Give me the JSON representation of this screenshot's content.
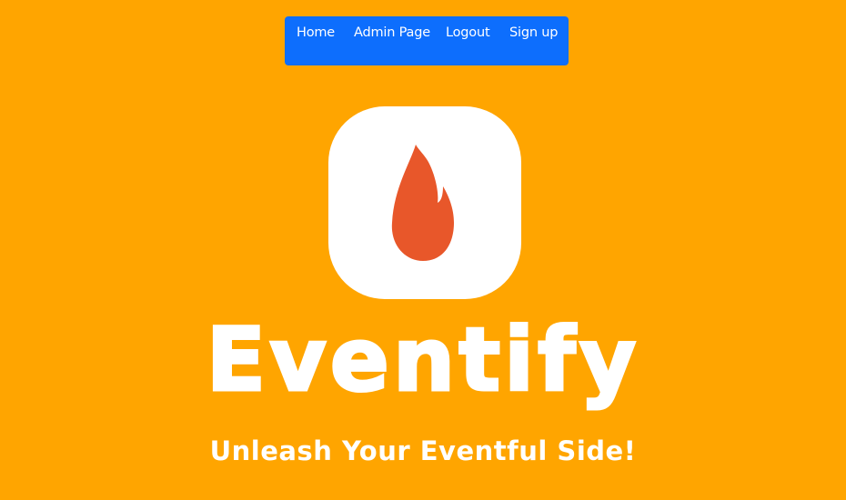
{
  "nav": {
    "items": [
      {
        "label": "Home"
      },
      {
        "label": "Admin Page"
      },
      {
        "label": "Logout"
      },
      {
        "label": "Sign up"
      }
    ],
    "bg_color": "#0D6EFD"
  },
  "hero": {
    "logo_icon": "flame-icon",
    "title": "Eventify",
    "tagline": "Unleash Your Eventful Side!"
  },
  "colors": {
    "page_background": "#FFA500",
    "flame": "#E8572A",
    "text": "#FFFFFF"
  }
}
